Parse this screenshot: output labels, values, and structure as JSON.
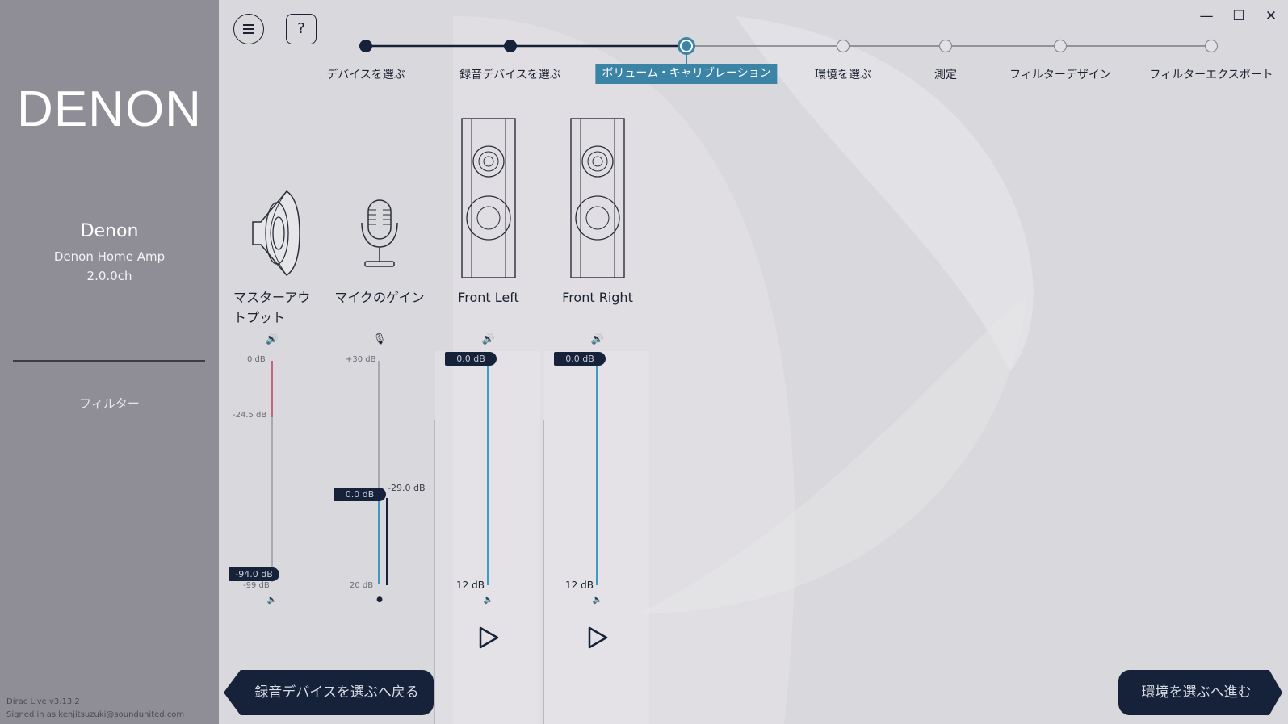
{
  "window": {
    "minimize_icon": "—",
    "maximize_icon": "☐",
    "close_icon": "✕"
  },
  "sidebar": {
    "logo": "DENON",
    "device_name": "Denon",
    "device_model": "Denon Home Amp",
    "channels": "2.0.0ch",
    "filter_link": "フィルター",
    "version": "Dirac Live v3.13.2",
    "signed_in": "Signed in as kenjitsuzuki@soundunited.com"
  },
  "header": {
    "help_label": "?"
  },
  "stepper": {
    "steps": [
      {
        "label": "デバイスを選ぶ",
        "state": "done"
      },
      {
        "label": "録音デバイスを選ぶ",
        "state": "done"
      },
      {
        "label": "ボリューム・キャリブレーション",
        "state": "active"
      },
      {
        "label": "環境を選ぶ",
        "state": "todo"
      },
      {
        "label": "測定",
        "state": "todo"
      },
      {
        "label": "フィルターデザイン",
        "state": "todo"
      },
      {
        "label": "フィルターエクスポート",
        "state": "todo"
      }
    ],
    "colors": {
      "done": "#15223a",
      "active": "#3c84a6",
      "todo": "#e2e2e6"
    }
  },
  "channels": {
    "master": {
      "label": "マスターアウトプット",
      "scale_top": "0 dB",
      "scale_mid": "-24.5 dB",
      "scale_bottom": "-99 dB",
      "value": "-94.0 dB",
      "level_color": "#c9627a"
    },
    "mic": {
      "label": "マイクのゲイン",
      "scale_top": "+30 dB",
      "scale_bottom": "20 dB",
      "value": "0.0 dB",
      "level_readout": "-29.0 dB"
    },
    "front_left": {
      "label": "Front Left",
      "value": "0.0 dB",
      "scale_bottom": "12 dB"
    },
    "front_right": {
      "label": "Front Right",
      "value": "0.0 dB",
      "scale_bottom": "12 dB"
    },
    "accent": "#3c9ac4"
  },
  "nav": {
    "back": "録音デバイスを選ぶへ戻る",
    "next": "環境を選ぶへ進む"
  }
}
